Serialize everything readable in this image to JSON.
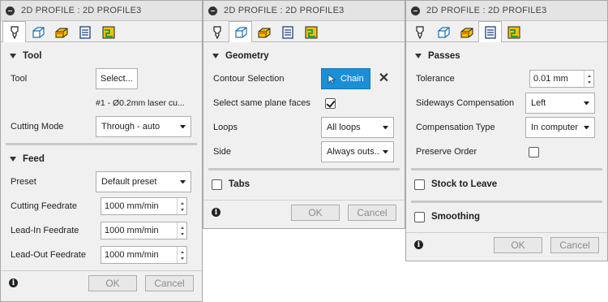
{
  "panels": [
    {
      "title": "2D PROFILE : 2D PROFILE3",
      "tool_section": {
        "title": "Tool",
        "tool_label": "Tool",
        "select_button": "Select...",
        "tool_name": "#1 - Ø0.2mm laser cu...",
        "cutting_mode_label": "Cutting Mode",
        "cutting_mode_value": "Through - auto"
      },
      "feed_section": {
        "title": "Feed",
        "preset_label": "Preset",
        "preset_value": "Default preset",
        "cutting_feedrate_label": "Cutting Feedrate",
        "cutting_feedrate_value": "1000 mm/min",
        "leadin_feedrate_label": "Lead-In Feedrate",
        "leadin_feedrate_value": "1000 mm/min",
        "leadout_feedrate_label": "Lead-Out Feedrate",
        "leadout_feedrate_value": "1000 mm/min"
      },
      "footer": {
        "ok": "OK",
        "cancel": "Cancel"
      }
    },
    {
      "title": "2D PROFILE : 2D PROFILE3",
      "geometry_section": {
        "title": "Geometry",
        "contour_label": "Contour Selection",
        "chain_button": "Chain",
        "same_plane_label": "Select same plane faces",
        "same_plane_checked": true,
        "loops_label": "Loops",
        "loops_value": "All loops",
        "side_label": "Side",
        "side_value": "Always outs..."
      },
      "tabs_section": {
        "title": "Tabs",
        "checked": false
      },
      "footer": {
        "ok": "OK",
        "cancel": "Cancel"
      }
    },
    {
      "title": "2D PROFILE : 2D PROFILE3",
      "passes_section": {
        "title": "Passes",
        "tolerance_label": "Tolerance",
        "tolerance_value": "0.01 mm",
        "sideways_label": "Sideways Compensation",
        "sideways_value": "Left",
        "comp_type_label": "Compensation Type",
        "comp_type_value": "In computer",
        "preserve_order_label": "Preserve Order",
        "preserve_order_checked": false
      },
      "stock_section": {
        "title": "Stock to Leave",
        "checked": false
      },
      "smoothing_section": {
        "title": "Smoothing",
        "checked": false
      },
      "footer": {
        "ok": "OK",
        "cancel": "Cancel"
      }
    }
  ],
  "tabs": [
    "tool-tab-icon",
    "geometry-tab-icon",
    "heights-tab-icon",
    "passes-tab-icon",
    "linking-tab-icon"
  ],
  "colors": {
    "chain_blue": "#1a8fd8",
    "panel_bg": "#f0f0f0",
    "tab_yellow": "#f3c300",
    "tab_green": "#2f9a3a"
  }
}
